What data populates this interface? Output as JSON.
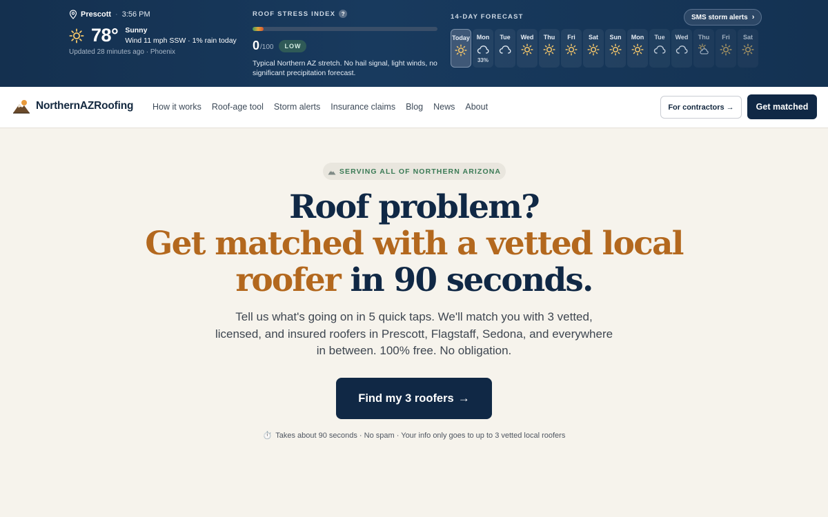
{
  "weather": {
    "location": "Prescott",
    "time": "3:56 PM",
    "temperature": "78°",
    "condition": "Sunny",
    "details": "Wind 11 mph SSW · 1% rain today",
    "updated": "Updated 28 minutes ago · Phoenix"
  },
  "roof_stress": {
    "title": "ROOF STRESS INDEX",
    "help": "?",
    "score": "0",
    "max": "/100",
    "level": "LOW",
    "description": "Typical Northern AZ stretch. No hail signal, light winds, no significant precipitation forecast.",
    "fill_fraction": 0.06
  },
  "forecast": {
    "title": "14-DAY FORECAST",
    "sms_label": "SMS storm alerts",
    "days": [
      {
        "label": "Today",
        "icon": "sun-icon",
        "precip": ""
      },
      {
        "label": "Mon",
        "icon": "cloud-icon",
        "precip": "33%"
      },
      {
        "label": "Tue",
        "icon": "cloud-icon",
        "precip": ""
      },
      {
        "label": "Wed",
        "icon": "sun-icon",
        "precip": ""
      },
      {
        "label": "Thu",
        "icon": "sun-icon",
        "precip": ""
      },
      {
        "label": "Fri",
        "icon": "sun-icon",
        "precip": ""
      },
      {
        "label": "Sat",
        "icon": "sun-icon",
        "precip": ""
      },
      {
        "label": "Sun",
        "icon": "sun-icon",
        "precip": ""
      },
      {
        "label": "Mon",
        "icon": "sun-icon",
        "precip": ""
      },
      {
        "label": "Tue",
        "icon": "cloud-icon",
        "precip": ""
      },
      {
        "label": "Wed",
        "icon": "cloud-icon",
        "precip": ""
      },
      {
        "label": "Thu",
        "icon": "partly-cloudy-icon",
        "precip": ""
      },
      {
        "label": "Fri",
        "icon": "sun-icon",
        "precip": ""
      },
      {
        "label": "Sat",
        "icon": "sun-icon",
        "precip": ""
      }
    ]
  },
  "nav": {
    "brand": "NorthernAZRoofing",
    "links": [
      "How it works",
      "Roof-age tool",
      "Storm alerts",
      "Insurance claims",
      "Blog",
      "News",
      "About"
    ],
    "contractors_label": "For contractors →",
    "get_matched_label": "Get matched"
  },
  "hero": {
    "badge": "SERVING ALL OF NORTHERN ARIZONA",
    "headline_1": "Roof problem?",
    "headline_2a": "Get matched with a vetted local",
    "headline_2b": "roofer",
    "headline_3": " in 90 seconds.",
    "subtext": "Tell us what's going on in 5 quick taps. We'll match you with 3 vetted, licensed, and insured roofers in Prescott, Flagstaff, Sedona, and everywhere in between. 100% free. No obligation.",
    "cta_label": "Find my 3 roofers",
    "cta_arrow": "→",
    "note_icon": "⏱️",
    "note": "Takes about 90 seconds · No spam · Your info only goes to up to 3 vetted local roofers"
  },
  "colors": {
    "navy": "#102845",
    "orange": "#b3681e",
    "green": "#3a7a55",
    "background": "#f6f3ec"
  }
}
